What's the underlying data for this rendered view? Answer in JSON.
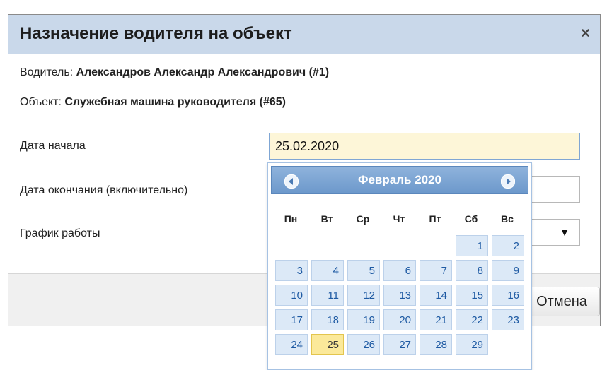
{
  "dialog": {
    "title": "Назначение водителя на объект",
    "close_label": "×",
    "driver_label": "Водитель:",
    "driver_value": "Александров Александр Александрович (#1)",
    "object_label": "Объект:",
    "object_value": "Служебная машина руководителя (#65)",
    "start_label": "Дата начала",
    "start_value": "25.02.2020",
    "end_label": "Дата окончания (включительно)",
    "end_value": "",
    "schedule_label": "График работы",
    "schedule_value": "",
    "cancel_label": "Отмена"
  },
  "calendar": {
    "month_title": "Февраль 2020",
    "weekdays": [
      "Пн",
      "Вт",
      "Ср",
      "Чт",
      "Пт",
      "Сб",
      "Вс"
    ],
    "selected_day": "25",
    "weeks": [
      [
        "",
        "",
        "",
        "",
        "",
        "1",
        "2"
      ],
      [
        "3",
        "4",
        "5",
        "6",
        "7",
        "8",
        "9"
      ],
      [
        "10",
        "11",
        "12",
        "13",
        "14",
        "15",
        "16"
      ],
      [
        "17",
        "18",
        "19",
        "20",
        "21",
        "22",
        "23"
      ],
      [
        "24",
        "25",
        "26",
        "27",
        "28",
        "29",
        ""
      ]
    ]
  },
  "colors": {
    "titlebar": "#c9d8ea",
    "calendar_header": "#6c98cb",
    "day_cell": "#dce9f7",
    "today_cell": "#fbe99a",
    "active_input": "#fdf6d8"
  }
}
